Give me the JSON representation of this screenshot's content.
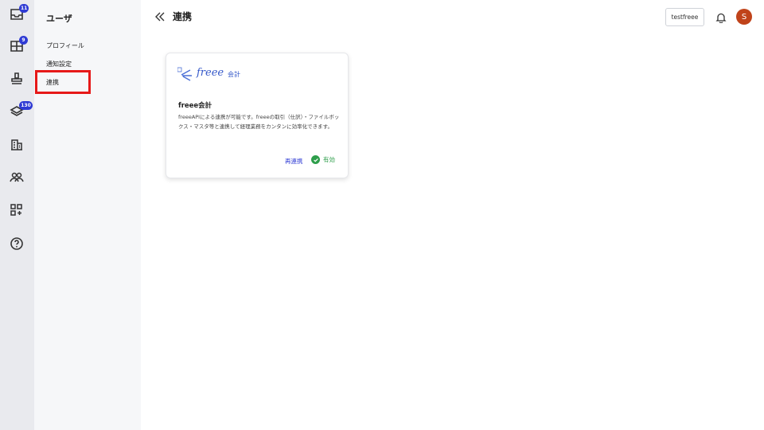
{
  "rail": {
    "items": [
      {
        "name": "inbox",
        "badge": "11"
      },
      {
        "name": "dashboard",
        "badge": "9"
      },
      {
        "name": "stamp",
        "badge": ""
      },
      {
        "name": "layers",
        "badge": "130"
      },
      {
        "name": "company",
        "badge": ""
      },
      {
        "name": "team",
        "badge": ""
      },
      {
        "name": "apps",
        "badge": ""
      },
      {
        "name": "help",
        "badge": ""
      }
    ],
    "badge_color": "#2f3bd4"
  },
  "subnav": {
    "title": "ユーザ",
    "items": [
      {
        "label": "プロフィール"
      },
      {
        "label": "通知設定"
      },
      {
        "label": "連携"
      }
    ],
    "highlight_color": "#e61919"
  },
  "header": {
    "title": "連携",
    "tenant": "testfreee",
    "avatar_initial": "S",
    "avatar_color": "#c0431a"
  },
  "card": {
    "logo_text": "freee",
    "logo_suffix": "会計",
    "title": "freee会計",
    "description": "freeeAPIによる連携が可能です。freeeの取引（仕訳）・ファイルボックス・マスタ等と連携して経理業務をカンタンに効率化できます。",
    "reconnect_label": "再連携",
    "status_label": "有効",
    "status_color": "#2e9e4b",
    "link_color": "#2f3bd4"
  }
}
